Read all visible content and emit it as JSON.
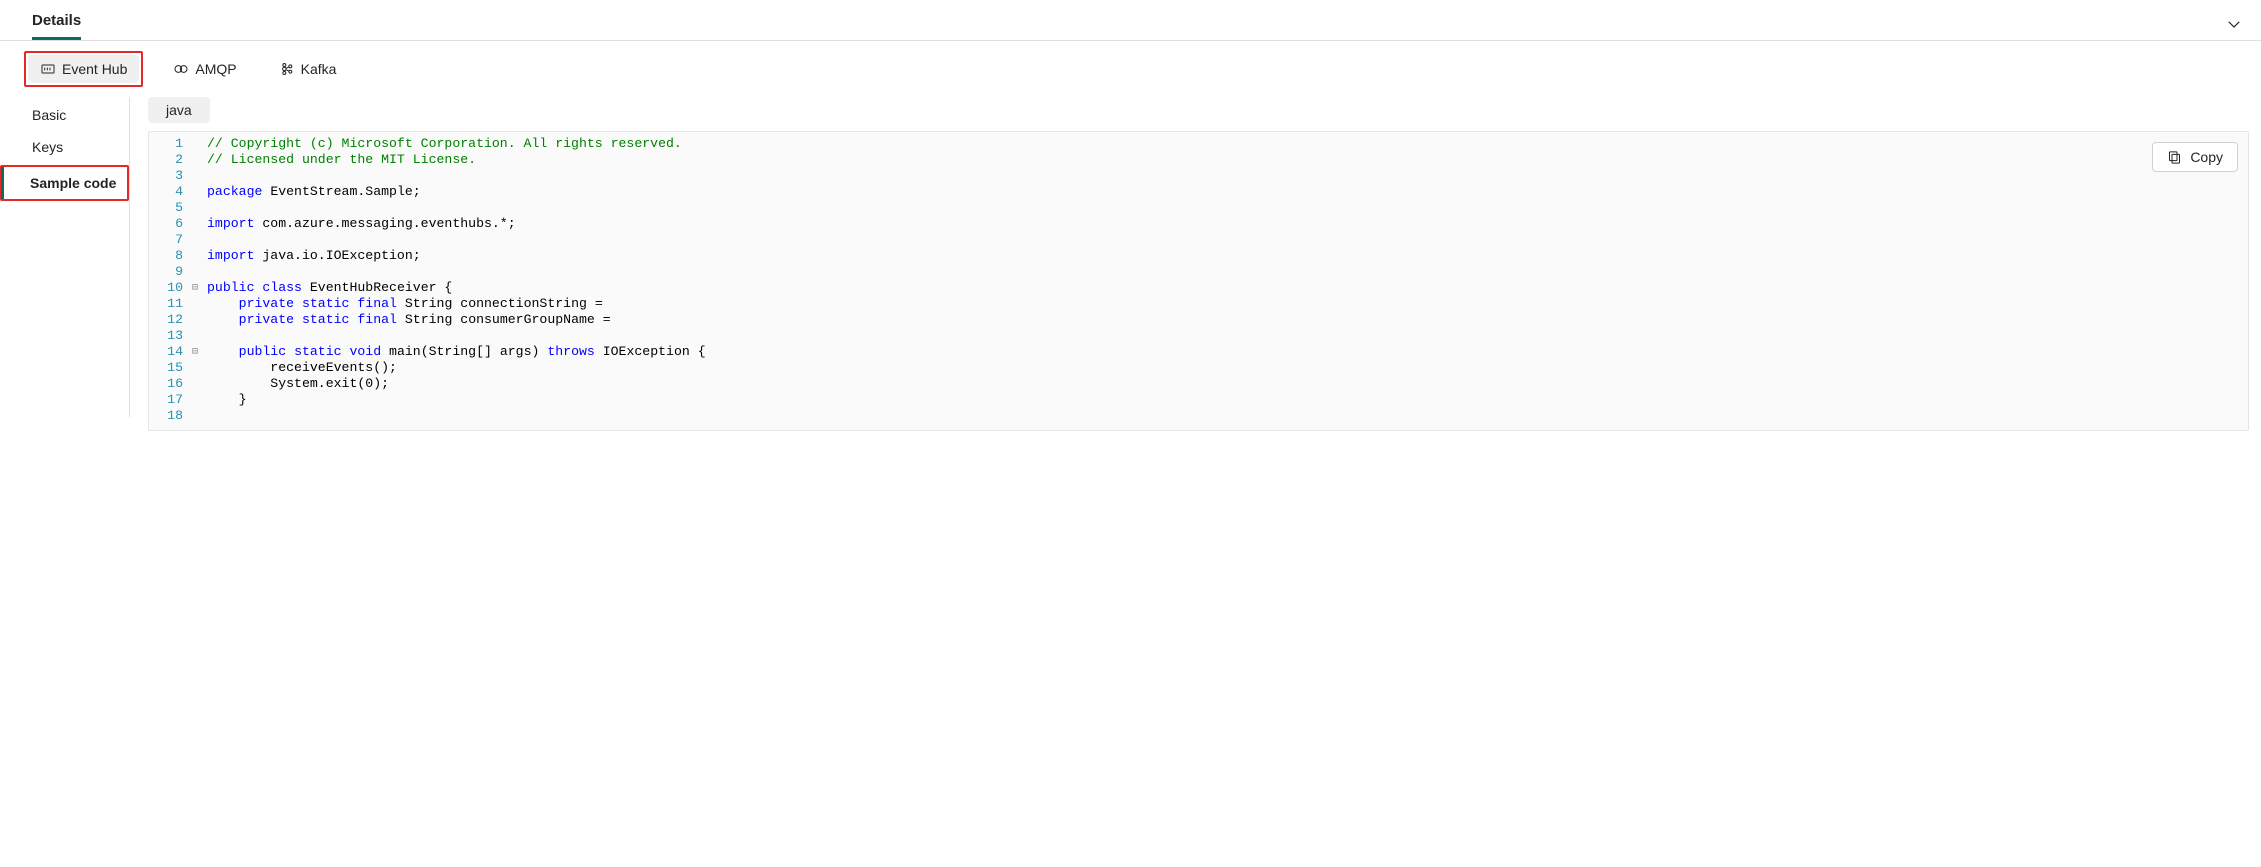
{
  "header": {
    "title": "Details"
  },
  "protocols": {
    "items": [
      {
        "id": "eventhub",
        "label": "Event Hub",
        "active": true,
        "highlighted": true
      },
      {
        "id": "amqp",
        "label": "AMQP",
        "active": false,
        "highlighted": false
      },
      {
        "id": "kafka",
        "label": "Kafka",
        "active": false,
        "highlighted": false
      }
    ]
  },
  "sidebar": {
    "items": [
      {
        "id": "basic",
        "label": "Basic",
        "selected": false,
        "highlighted": false
      },
      {
        "id": "keys",
        "label": "Keys",
        "selected": false,
        "highlighted": false
      },
      {
        "id": "samplecode",
        "label": "Sample code",
        "selected": true,
        "highlighted": true
      }
    ]
  },
  "code": {
    "language": "java",
    "copy_label": "Copy",
    "lines": [
      {
        "n": 1,
        "fold": false,
        "tokens": [
          [
            "c",
            "// Copyright (c) Microsoft Corporation. All rights reserved."
          ]
        ]
      },
      {
        "n": 2,
        "fold": false,
        "tokens": [
          [
            "c",
            "// Licensed under the MIT License."
          ]
        ]
      },
      {
        "n": 3,
        "fold": false,
        "tokens": []
      },
      {
        "n": 4,
        "fold": false,
        "tokens": [
          [
            "k",
            "package"
          ],
          [
            "s",
            " EventStream.Sample;"
          ]
        ]
      },
      {
        "n": 5,
        "fold": false,
        "tokens": []
      },
      {
        "n": 6,
        "fold": false,
        "tokens": [
          [
            "k",
            "import"
          ],
          [
            "s",
            " com.azure.messaging.eventhubs.*;"
          ]
        ]
      },
      {
        "n": 7,
        "fold": false,
        "tokens": []
      },
      {
        "n": 8,
        "fold": false,
        "tokens": [
          [
            "k",
            "import"
          ],
          [
            "s",
            " java.io.IOException;"
          ]
        ]
      },
      {
        "n": 9,
        "fold": false,
        "tokens": []
      },
      {
        "n": 10,
        "fold": true,
        "tokens": [
          [
            "k",
            "public"
          ],
          [
            "s",
            " "
          ],
          [
            "k",
            "class"
          ],
          [
            "s",
            " EventHubReceiver {"
          ]
        ]
      },
      {
        "n": 11,
        "fold": false,
        "tokens": [
          [
            "s",
            "    "
          ],
          [
            "k",
            "private"
          ],
          [
            "s",
            " "
          ],
          [
            "k",
            "static"
          ],
          [
            "s",
            " "
          ],
          [
            "k",
            "final"
          ],
          [
            "s",
            " String connectionString ="
          ]
        ]
      },
      {
        "n": 12,
        "fold": false,
        "tokens": [
          [
            "s",
            "    "
          ],
          [
            "k",
            "private"
          ],
          [
            "s",
            " "
          ],
          [
            "k",
            "static"
          ],
          [
            "s",
            " "
          ],
          [
            "k",
            "final"
          ],
          [
            "s",
            " String consumerGroupName ="
          ]
        ]
      },
      {
        "n": 13,
        "fold": false,
        "tokens": []
      },
      {
        "n": 14,
        "fold": true,
        "tokens": [
          [
            "s",
            "    "
          ],
          [
            "k",
            "public"
          ],
          [
            "s",
            " "
          ],
          [
            "k",
            "static"
          ],
          [
            "s",
            " "
          ],
          [
            "k",
            "void"
          ],
          [
            "s",
            " main(String[] args) "
          ],
          [
            "k",
            "throws"
          ],
          [
            "s",
            " IOException {"
          ]
        ]
      },
      {
        "n": 15,
        "fold": false,
        "tokens": [
          [
            "s",
            "        receiveEvents();"
          ]
        ]
      },
      {
        "n": 16,
        "fold": false,
        "tokens": [
          [
            "s",
            "        System.exit("
          ],
          [
            "n",
            "0"
          ],
          [
            "s",
            ");"
          ]
        ]
      },
      {
        "n": 17,
        "fold": false,
        "tokens": [
          [
            "s",
            "    }"
          ]
        ]
      },
      {
        "n": 18,
        "fold": false,
        "tokens": []
      }
    ]
  }
}
